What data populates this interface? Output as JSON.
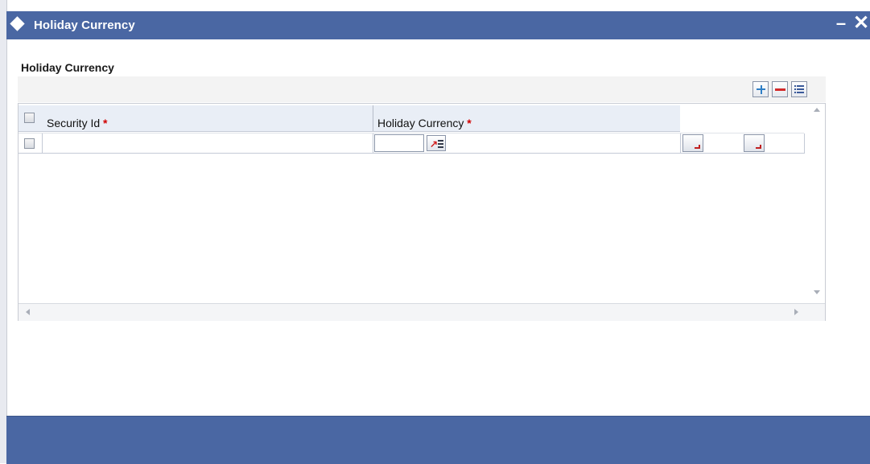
{
  "window": {
    "title": "Holiday Currency",
    "minimize_glyph": "–",
    "close_glyph": "✕"
  },
  "section": {
    "title": "Holiday Currency"
  },
  "toolbar": {
    "icons": [
      "add-row-icon",
      "delete-row-icon",
      "single-view-icon"
    ]
  },
  "grid": {
    "columns": [
      {
        "label": "Security Id",
        "required_mark": "*"
      },
      {
        "label": "Holiday Currency",
        "required_mark": "*"
      }
    ],
    "rows": [
      {
        "security_id": "",
        "holiday_currency": ""
      }
    ]
  },
  "colors": {
    "titlebar": "#4a67a3",
    "header_row": "#e9eef6",
    "required": "#d10000"
  }
}
